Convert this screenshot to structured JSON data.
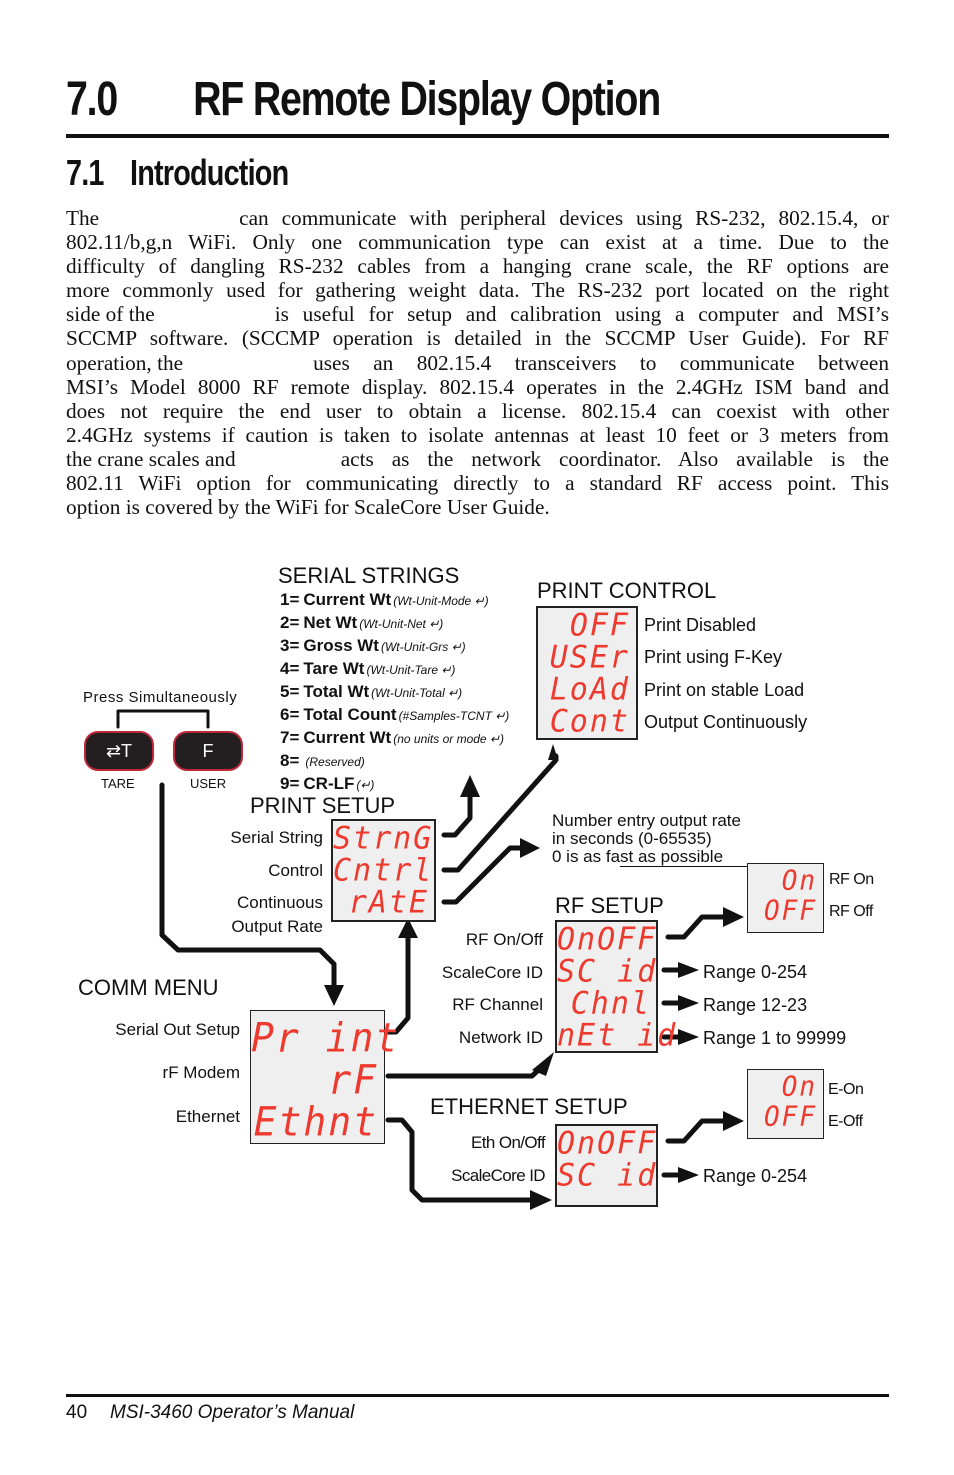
{
  "heading": {
    "number": "7.0",
    "title": "RF Remote Display Option"
  },
  "subheading": {
    "number": "7.1",
    "title": "Introduction"
  },
  "intro_lines": [
    [
      "The",
      "can communicate with peripheral devices using RS-232, 802.15.4, or"
    ],
    [
      "802.11/b,g,n WiFi. Only one communication type can exist at a time. Due to the"
    ],
    [
      "difficulty of dangling RS-232 cables from a hanging crane scale, the RF options are"
    ],
    [
      "more commonly used for gathering weight data.  The RS-232 port located on the right"
    ],
    [
      "side of the",
      "is useful for setup and calibration using a computer and MSI’s"
    ],
    [
      "SCCMP software. (SCCMP operation is detailed in the SCCMP User Guide). For RF"
    ],
    [
      "operation, the",
      "uses an 802.15.4 transceivers to communicate between"
    ],
    [
      "MSI’s Model 8000 RF remote display. 802.15.4 operates in the 2.4GHz ISM band and"
    ],
    [
      "does not require the end user to obtain a license. 802.15.4 can coexist with other"
    ],
    [
      "2.4GHz systems if caution is taken to isolate antennas at least 10 feet or 3 meters from"
    ],
    [
      "the crane scales and",
      "acts as the network coordinator. Also available is the"
    ],
    [
      "802.11 WiFi option for communicating directly to a standard RF access point. This"
    ],
    [
      "option is covered by the WiFi for ScaleCore User Guide."
    ]
  ],
  "diagram": {
    "keys": {
      "press_label": "Press Simultaneously",
      "tare": {
        "glyph": "⇄T",
        "label": "TARE"
      },
      "user": {
        "glyph": "F",
        "label": "USER"
      }
    },
    "serial_strings": {
      "title": "SERIAL STRINGS",
      "items": [
        {
          "prefix": "1=",
          "name": "Current Wt",
          "note": "(Wt-Unit-Mode ↵)"
        },
        {
          "prefix": "2=",
          "name": "Net Wt",
          "note": "(Wt-Unit-Net ↵)"
        },
        {
          "prefix": "3=",
          "name": "Gross Wt",
          "note": "(Wt-Unit-Grs ↵)"
        },
        {
          "prefix": "4=",
          "name": "Tare Wt",
          "note": "(Wt-Unit-Tare ↵)"
        },
        {
          "prefix": "5=",
          "name": "Total Wt",
          "note": "(Wt-Unit-Total ↵)"
        },
        {
          "prefix": "6=",
          "name": "Total Count",
          "note": "(#Samples-TCNT ↵)"
        },
        {
          "prefix": "7=",
          "name": "Current Wt",
          "note": "(no units or mode ↵)"
        },
        {
          "prefix": "8=",
          "name": "",
          "note": "(Reserved)"
        },
        {
          "prefix": "9=",
          "name": "CR-LF",
          "note": "(↵)"
        }
      ]
    },
    "print_control": {
      "title": "PRINT CONTROL",
      "display": [
        "OFF",
        "USEr",
        "LoAd",
        "Cont"
      ],
      "labels": [
        "Print Disabled",
        "Print using F-Key",
        "Print on stable Load",
        "Output Continuously"
      ]
    },
    "print_setup": {
      "title": "PRINT SETUP",
      "display": [
        "StrnG",
        "Cntrl",
        "rAtE"
      ],
      "labels": [
        "Serial String",
        "Control",
        "Continuous",
        "Output Rate"
      ]
    },
    "rate_note": [
      "Number entry output rate",
      "in seconds (0-65535)",
      "0 is as fast as possible"
    ],
    "rf_setup": {
      "title": "RF SETUP",
      "display": [
        "OnOFF",
        "SC id",
        "Chnl",
        "nEt id"
      ],
      "labels": [
        "RF On/Off",
        "ScaleCore ID",
        "RF Channel",
        "Network ID"
      ],
      "ranges": [
        "Range 0-254",
        "Range 12-23",
        "Range 1 to 99999"
      ],
      "onoff_display": [
        "On",
        "OFF"
      ],
      "onoff_labels": [
        "RF On",
        "RF Off"
      ]
    },
    "comm_menu": {
      "title": "COMM MENU",
      "display": [
        "Pr int",
        "rF",
        "Ethnt"
      ],
      "labels": [
        "Serial Out Setup",
        "rF Modem",
        "Ethernet"
      ]
    },
    "ethernet_setup": {
      "title": "ETHERNET SETUP",
      "display": [
        "OnOFF",
        "SC id"
      ],
      "labels": [
        "Eth On/Off",
        "ScaleCore ID"
      ],
      "ranges": [
        "Range 0-254"
      ],
      "onoff_display": [
        "On",
        "OFF"
      ],
      "onoff_labels": [
        "E-On",
        "E-Off"
      ]
    },
    "colors": {
      "segment_red": "#ee3a2e",
      "lcd_bg": "#efefef",
      "key_bg": "#231f20",
      "key_border": "#c0283a"
    }
  },
  "footer": {
    "page": "40",
    "title": "MSI-3460 Operator’s Manual"
  }
}
